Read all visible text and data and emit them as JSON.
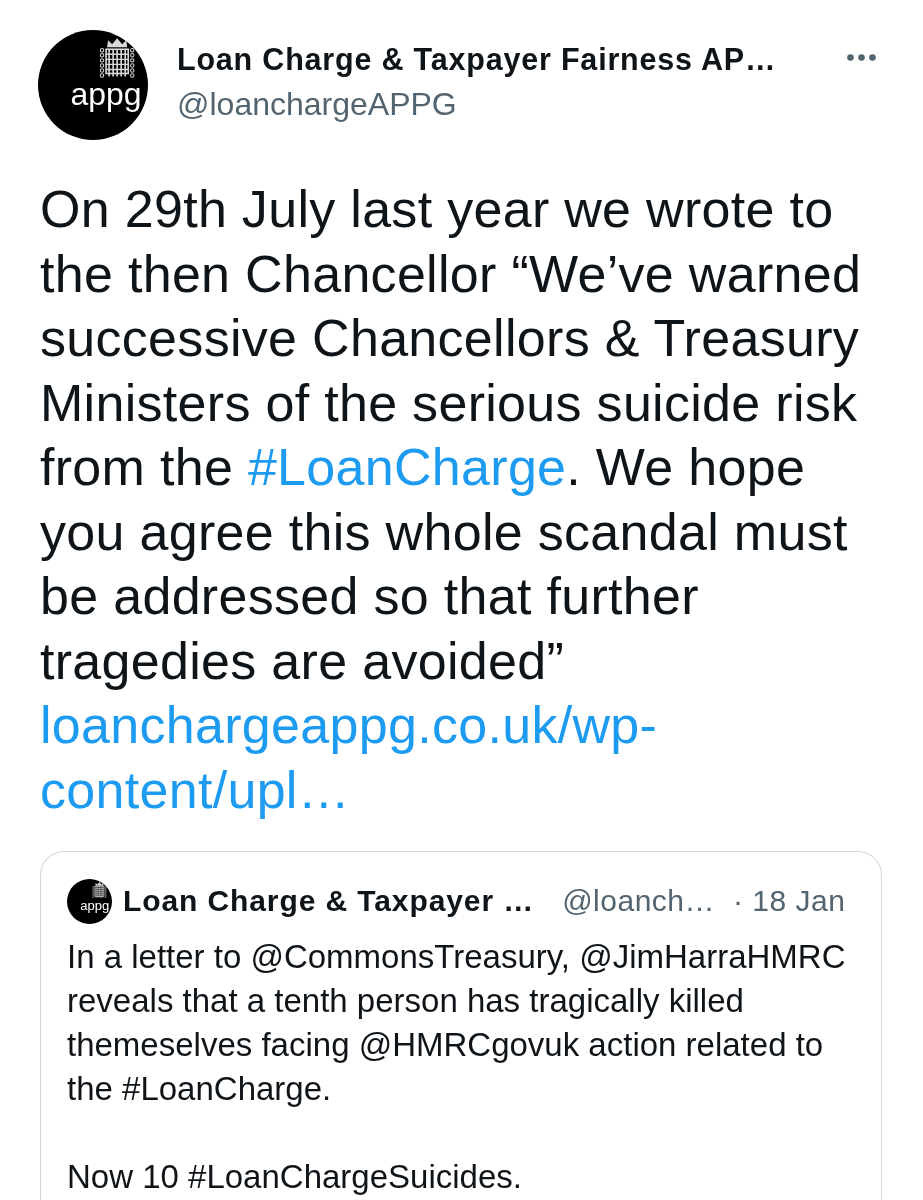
{
  "tweet": {
    "author": {
      "name": "Loan Charge & Taxpayer Fairness AP…",
      "handle": "@loanchargeAPPG",
      "avatar_text": "appg"
    },
    "body": [
      {
        "kind": "text",
        "text": "On 29th July last year we wrote to the then Chancellor “We’ve warned successive Chancellors & Treasury Ministers of the serious suicide risk from the "
      },
      {
        "kind": "hashtag",
        "text": "#LoanCharge"
      },
      {
        "kind": "text",
        "text": ". We hope you agree this whole scandal must be addressed so that further tragedies are avoided” "
      },
      {
        "kind": "link",
        "text": "loanchargeappg.co.uk/wp-content/upl…"
      }
    ],
    "quoted": {
      "author": {
        "name": "Loan Charge & Taxpayer …",
        "handle": "@loanch…",
        "avatar_text": "appg"
      },
      "time": "· 18 Jan",
      "paragraphs": [
        "In a letter to @CommonsTreasury, @JimHarraHMRC reveals that a tenth person has tragically killed themeselves facing @HMRCgovuk action related to the #LoanCharge.",
        "Now 10 #LoanChargeSuicides."
      ]
    }
  }
}
